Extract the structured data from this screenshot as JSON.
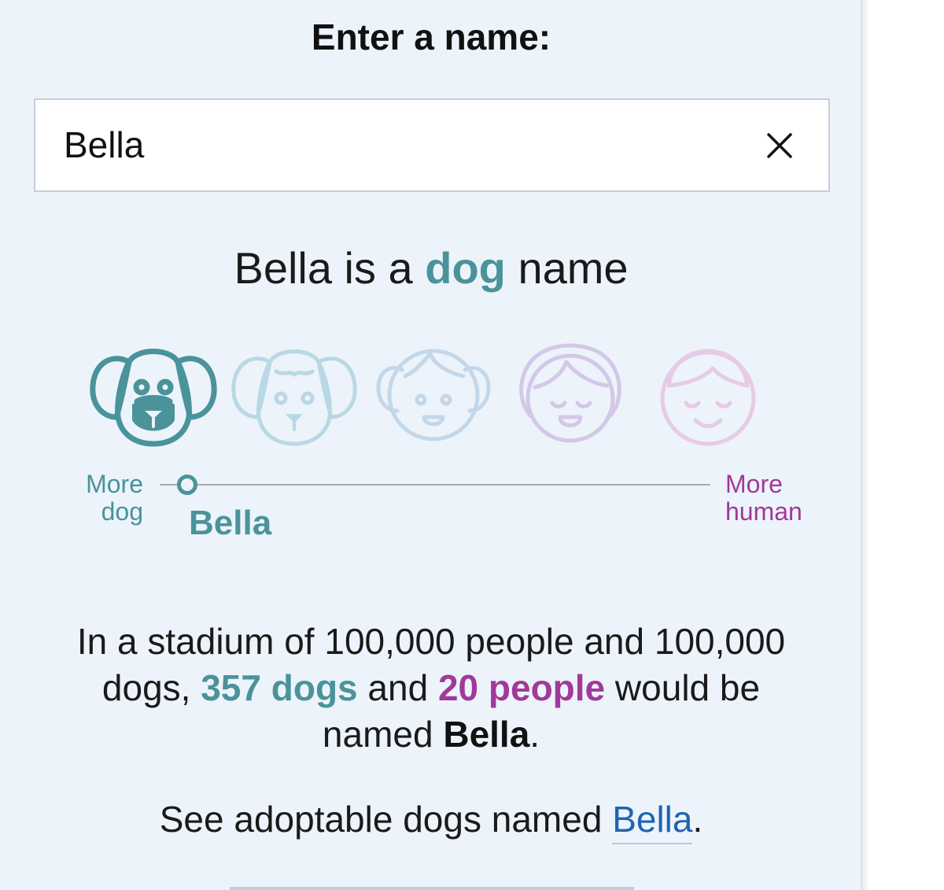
{
  "form": {
    "heading": "Enter a name:",
    "input_value": "Bella",
    "clear_icon": "close-icon"
  },
  "result": {
    "prefix": "Bella is a ",
    "kind": "dog",
    "suffix": " name"
  },
  "scale": {
    "left_label_line1": "More",
    "left_label_line2": "dog",
    "right_label_line1": "More",
    "right_label_line2": "human",
    "marker_name": "Bella",
    "marker_position": 0.05,
    "faces": [
      "dog-face-icon",
      "dog-face-light-icon",
      "child-face-icon",
      "woman-face-icon",
      "boy-face-icon"
    ],
    "face_colors": [
      "#4a939b",
      "#b9d8e6",
      "#c3d7ea",
      "#d3c8e8",
      "#e7cbe6"
    ]
  },
  "stadium": {
    "line1": "In a stadium of 100,000 people and 100,000",
    "line2_start": "dogs, ",
    "dogs_count": "357 dogs",
    "and": " and ",
    "people_count": "20 people",
    "line2_end": " would be",
    "line3_start": "named ",
    "name": "Bella",
    "line3_end": "."
  },
  "adopt": {
    "text": "See adoptable dogs named ",
    "link": "Bella",
    "end": "."
  },
  "colors": {
    "dog": "#4a939b",
    "human": "#a0399a",
    "link": "#1e65b2",
    "panel_bg": "#edf3fa"
  }
}
